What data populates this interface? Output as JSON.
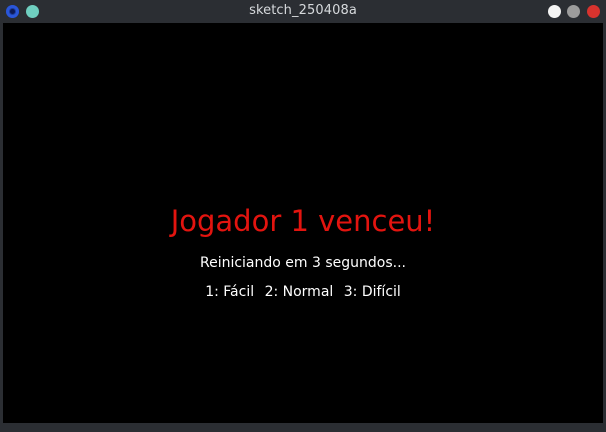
{
  "window": {
    "title": "sketch_250408a"
  },
  "colors": {
    "headline": "#e3140f",
    "canvas_background": "#000000",
    "text": "#ffffff"
  },
  "game": {
    "winner_message": "Jogador 1 venceu!",
    "restart_message": "Reiniciando em 3 segundos...",
    "difficulty_options": [
      "1: Fácil",
      "2: Normal",
      "3: Difícil"
    ]
  }
}
